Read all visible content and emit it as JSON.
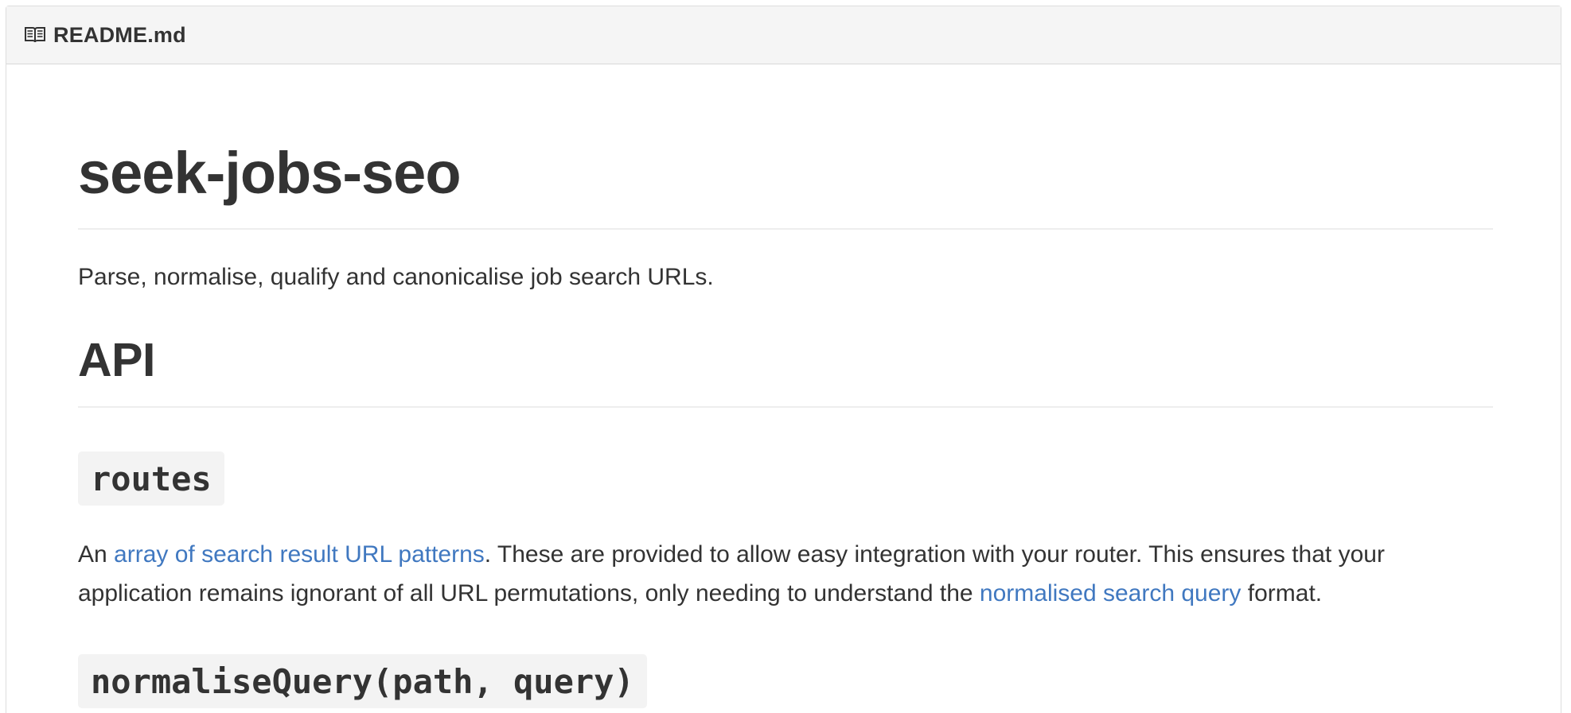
{
  "header": {
    "filename": "README.md",
    "icon": "book-icon"
  },
  "content": {
    "title": "seek-jobs-seo",
    "description": "Parse, normalise, qualify and canonicalise job search URLs.",
    "api_heading": "API",
    "routes_heading": "routes",
    "routes_paragraph": {
      "part1": "An ",
      "link1": "array of search result URL patterns",
      "part2": ". These are provided to allow easy integration with your router. This ensures that your application remains ignorant of all URL permutations, only needing to understand the ",
      "link2": "normalised search query",
      "part3": " format."
    },
    "normalise_heading": "normaliseQuery(path, query)"
  },
  "colors": {
    "link": "#4078c0",
    "text": "#333333",
    "header_bg": "#f5f5f5",
    "code_bg": "#f3f3f3"
  }
}
